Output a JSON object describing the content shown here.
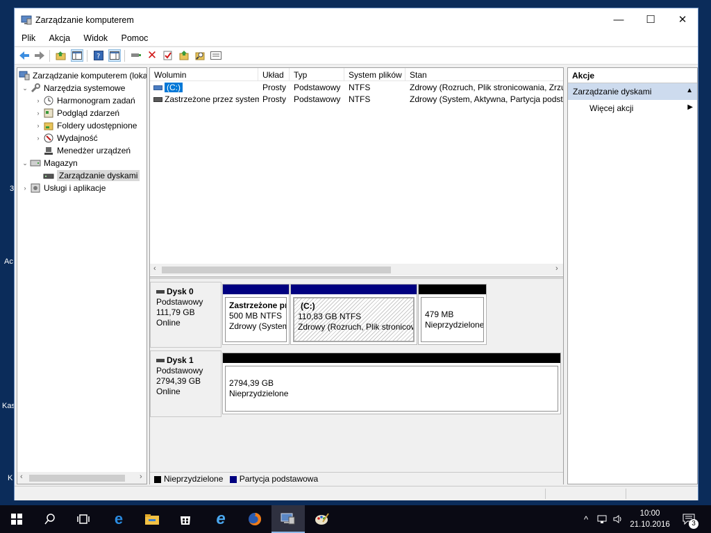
{
  "desktop": {
    "labels": [
      "3",
      "Ac",
      "Kas",
      "K"
    ]
  },
  "window": {
    "title": "Zarządzanie komputerem",
    "controls": {
      "minimize": "—",
      "maximize": "☐",
      "close": "✕"
    }
  },
  "menu": [
    "Plik",
    "Akcja",
    "Widok",
    "Pomoc"
  ],
  "toolbar": [
    "back-icon",
    "forward-icon",
    "up-folder-icon",
    "show-hide-tree-icon",
    "help-icon",
    "show-hide-action-pane-icon",
    "connect-icon",
    "delete-icon",
    "check-icon",
    "export-icon",
    "search-icon",
    "properties-icon"
  ],
  "tree": {
    "items": [
      {
        "label": "Zarządzanie komputerem (loka",
        "level": 0,
        "arrow": "",
        "icon": "computer-management-icon"
      },
      {
        "label": "Narzędzia systemowe",
        "level": 1,
        "arrow": "⌄",
        "icon": "tools-icon"
      },
      {
        "label": "Harmonogram zadań",
        "level": 2,
        "arrow": "›",
        "icon": "clock-icon"
      },
      {
        "label": "Podgląd zdarzeń",
        "level": 2,
        "arrow": "›",
        "icon": "event-viewer-icon"
      },
      {
        "label": "Foldery udostępnione",
        "level": 2,
        "arrow": "›",
        "icon": "shared-folder-icon"
      },
      {
        "label": "Wydajność",
        "level": 2,
        "arrow": "›",
        "icon": "performance-icon"
      },
      {
        "label": "Menedżer urządzeń",
        "level": 2,
        "arrow": "",
        "icon": "device-manager-icon"
      },
      {
        "label": "Magazyn",
        "level": 1,
        "arrow": "⌄",
        "icon": "storage-icon"
      },
      {
        "label": "Zarządzanie dyskami",
        "level": 2,
        "arrow": "",
        "icon": "disk-management-icon",
        "selected": true
      },
      {
        "label": "Usługi i aplikacje",
        "level": 1,
        "arrow": "›",
        "icon": "services-icon"
      }
    ]
  },
  "volumes": {
    "columns": [
      "Wolumin",
      "Układ",
      "Typ",
      "System plików",
      "Stan"
    ],
    "rows": [
      {
        "name": "(C:)",
        "layout": "Prosty",
        "type": "Podstawowy",
        "fs": "NTFS",
        "status": "Zdrowy (Rozruch, Plik stronicowania, Zrzu"
      },
      {
        "name": "Zastrzeżone przez system",
        "layout": "Prosty",
        "type": "Podstawowy",
        "fs": "NTFS",
        "status": "Zdrowy (System, Aktywna, Partycja podsta"
      }
    ]
  },
  "disks": [
    {
      "name": "Dysk 0",
      "type": "Podstawowy",
      "size": "111,79 GB",
      "state": "Online",
      "partitions": [
        {
          "title": "Zastrzeżone pr",
          "size": "500 MB NTFS",
          "status": "Zdrowy (System",
          "kind": "primary"
        },
        {
          "title": "(C:)",
          "size": "110,83 GB NTFS",
          "status": "Zdrowy (Rozruch, Plik stronicow",
          "kind": "primary",
          "selected": true
        },
        {
          "title": "",
          "size": "479 MB",
          "status": "Nieprzydzielone",
          "kind": "unallocated"
        }
      ]
    },
    {
      "name": "Dysk 1",
      "type": "Podstawowy",
      "size": "2794,39 GB",
      "state": "Online",
      "partitions": [
        {
          "title": "",
          "size": "2794,39 GB",
          "status": "Nieprzydzielone",
          "kind": "unallocated"
        }
      ]
    }
  ],
  "legend": [
    {
      "label": "Nieprzydzielone",
      "color": "#000000"
    },
    {
      "label": "Partycja podstawowa",
      "color": "#000080"
    }
  ],
  "actions": {
    "header": "Akcje",
    "section": "Zarządzanie dyskami",
    "items": [
      "Więcej akcji"
    ]
  },
  "taskbar": {
    "time": "10:00",
    "date": "21.10.2016",
    "notifications": "3"
  },
  "colors": {
    "primary_partition": "#000080",
    "unallocated": "#000000",
    "selection": "#0078d7"
  }
}
